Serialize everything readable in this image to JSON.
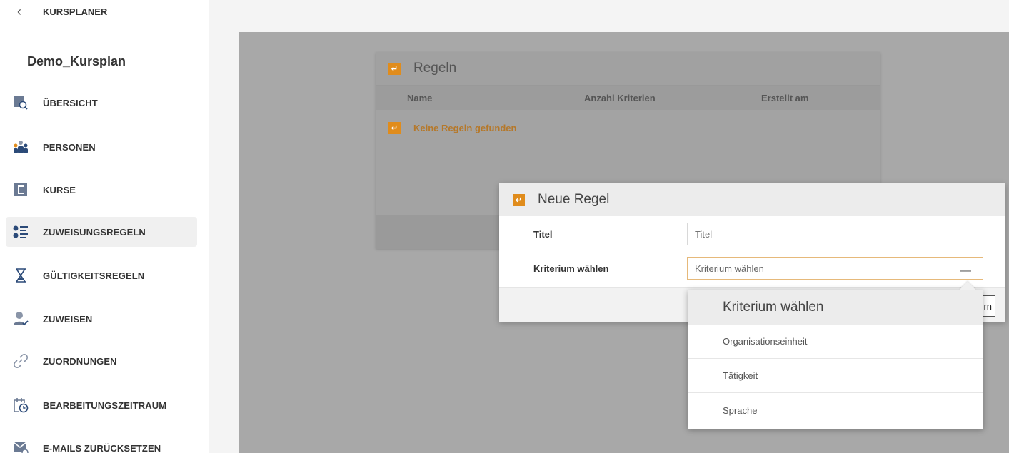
{
  "sidebar": {
    "crumb": "KURSPLANER",
    "project": "Demo_Kursplan",
    "items": [
      {
        "label": "ÜBERSICHT"
      },
      {
        "label": "PERSONEN"
      },
      {
        "label": "KURSE"
      },
      {
        "label": "ZUWEISUNGSREGELN"
      },
      {
        "label": "GÜLTIGKEITSREGELN"
      },
      {
        "label": "ZUWEISEN"
      },
      {
        "label": "ZUORDNUNGEN"
      },
      {
        "label": "BEARBEITUNGSZEITRAUM"
      },
      {
        "label": "E-MAILS ZURÜCKSETZEN"
      }
    ]
  },
  "rules": {
    "title": "Regeln",
    "columns": [
      "Name",
      "Anzahl Kriterien",
      "Erstellt am"
    ],
    "empty": "Keine Regeln gefunden"
  },
  "modal": {
    "title": "Neue Regel",
    "title_label": "Titel",
    "title_placeholder": "Titel",
    "criterion_label": "Kriterium wählen",
    "criterion_value": "Kriterium wählen",
    "save_fragment": "rn"
  },
  "dropdown": {
    "header": "Kriterium wählen",
    "options": [
      "Organisationseinheit",
      "Tätigkeit",
      "Sprache"
    ]
  },
  "colors": {
    "accent": "#e08c1c",
    "icon_blue": "#2b4a78"
  }
}
